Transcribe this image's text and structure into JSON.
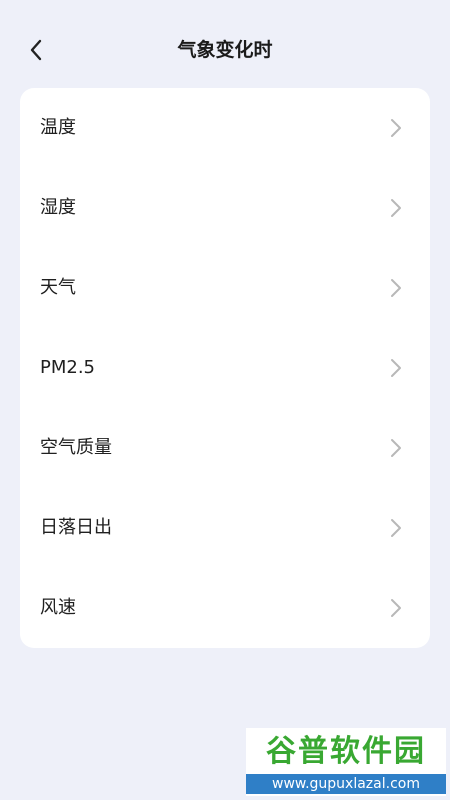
{
  "header": {
    "title": "气象变化时",
    "back_icon": "chevron-left-icon"
  },
  "menu": {
    "items": [
      {
        "label": "温度",
        "icon": "chevron-right-icon"
      },
      {
        "label": "湿度",
        "icon": "chevron-right-icon"
      },
      {
        "label": "天气",
        "icon": "chevron-right-icon"
      },
      {
        "label": "PM2.5",
        "icon": "chevron-right-icon"
      },
      {
        "label": "空气质量",
        "icon": "chevron-right-icon"
      },
      {
        "label": "日落日出",
        "icon": "chevron-right-icon"
      },
      {
        "label": "风速",
        "icon": "chevron-right-icon"
      }
    ]
  },
  "watermark": {
    "logo": "谷普软件园",
    "url": "www.gupuxlazal.com"
  },
  "colors": {
    "background": "#eef0f9",
    "card": "#ffffff",
    "chevron": "#b8b8b8",
    "watermark_green": "#39a832",
    "watermark_blue": "#2f7fc7"
  }
}
